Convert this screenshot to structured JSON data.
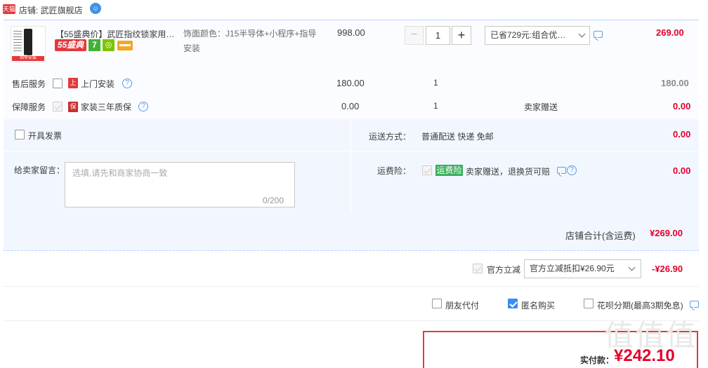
{
  "shop": {
    "platform_badge": "天猫",
    "label": "店铺: 武匠旗舰店"
  },
  "product": {
    "title": "【55盛典价】武匠指纹锁家用…",
    "badge_promo": "55盛典",
    "badge_seven": "7",
    "badge_thumb_text": "指导安装",
    "sku": "饰面颜色：J15半导体+小程序+指导安装",
    "price": "998.00",
    "quantity": "1",
    "qty_minus": "−",
    "qty_plus": "+",
    "promotion": "已省729元:组合优…",
    "subtotal": "269.00"
  },
  "services": [
    {
      "category": "售后服务",
      "name": "上门安装",
      "icon_text": "上",
      "price": "180.00",
      "qty": "1",
      "note": "",
      "amount": "180.00",
      "checked": false
    },
    {
      "category": "保障服务",
      "name": "家装三年质保",
      "icon_text": "保",
      "price": "0.00",
      "qty": "1",
      "note": "卖家赠送",
      "amount": "0.00",
      "checked": true
    }
  ],
  "invoice": {
    "label": "开具发票"
  },
  "shipping": {
    "label": "运送方式：",
    "value": "普通配送 快递 免邮",
    "amount": "0.00"
  },
  "message": {
    "label": "给卖家留言：",
    "placeholder": "选填,请先和商家协商一致",
    "counter": "0/200"
  },
  "insurance": {
    "label": "运费险：",
    "tag": "运费险",
    "desc": "卖家赠送，退换货可赔",
    "amount": "0.00"
  },
  "shop_total": {
    "label": "店铺合计(含运费)",
    "amount": "¥269.00"
  },
  "discount": {
    "label": "官方立减",
    "selected": "官方立减抵扣¥26.90元",
    "amount": "-¥26.90"
  },
  "options": [
    {
      "label": "朋友代付",
      "checked": false
    },
    {
      "label": "匿名购买",
      "checked": true
    },
    {
      "label": "花呗分期(最高3期免息)",
      "checked": false
    }
  ],
  "payment": {
    "label": "实付款：",
    "amount": "¥242.10"
  },
  "watermark": "值值值",
  "colors": {
    "accent_red": "#e4002b",
    "blue": "#3b8cf4",
    "panel_bg": "#f2f7ff",
    "green_tag": "#3aaf5c"
  },
  "icons": {
    "chat": "chat-bubble-icon",
    "help": "question-circle-icon",
    "dropdown": "chevron-down-icon"
  }
}
